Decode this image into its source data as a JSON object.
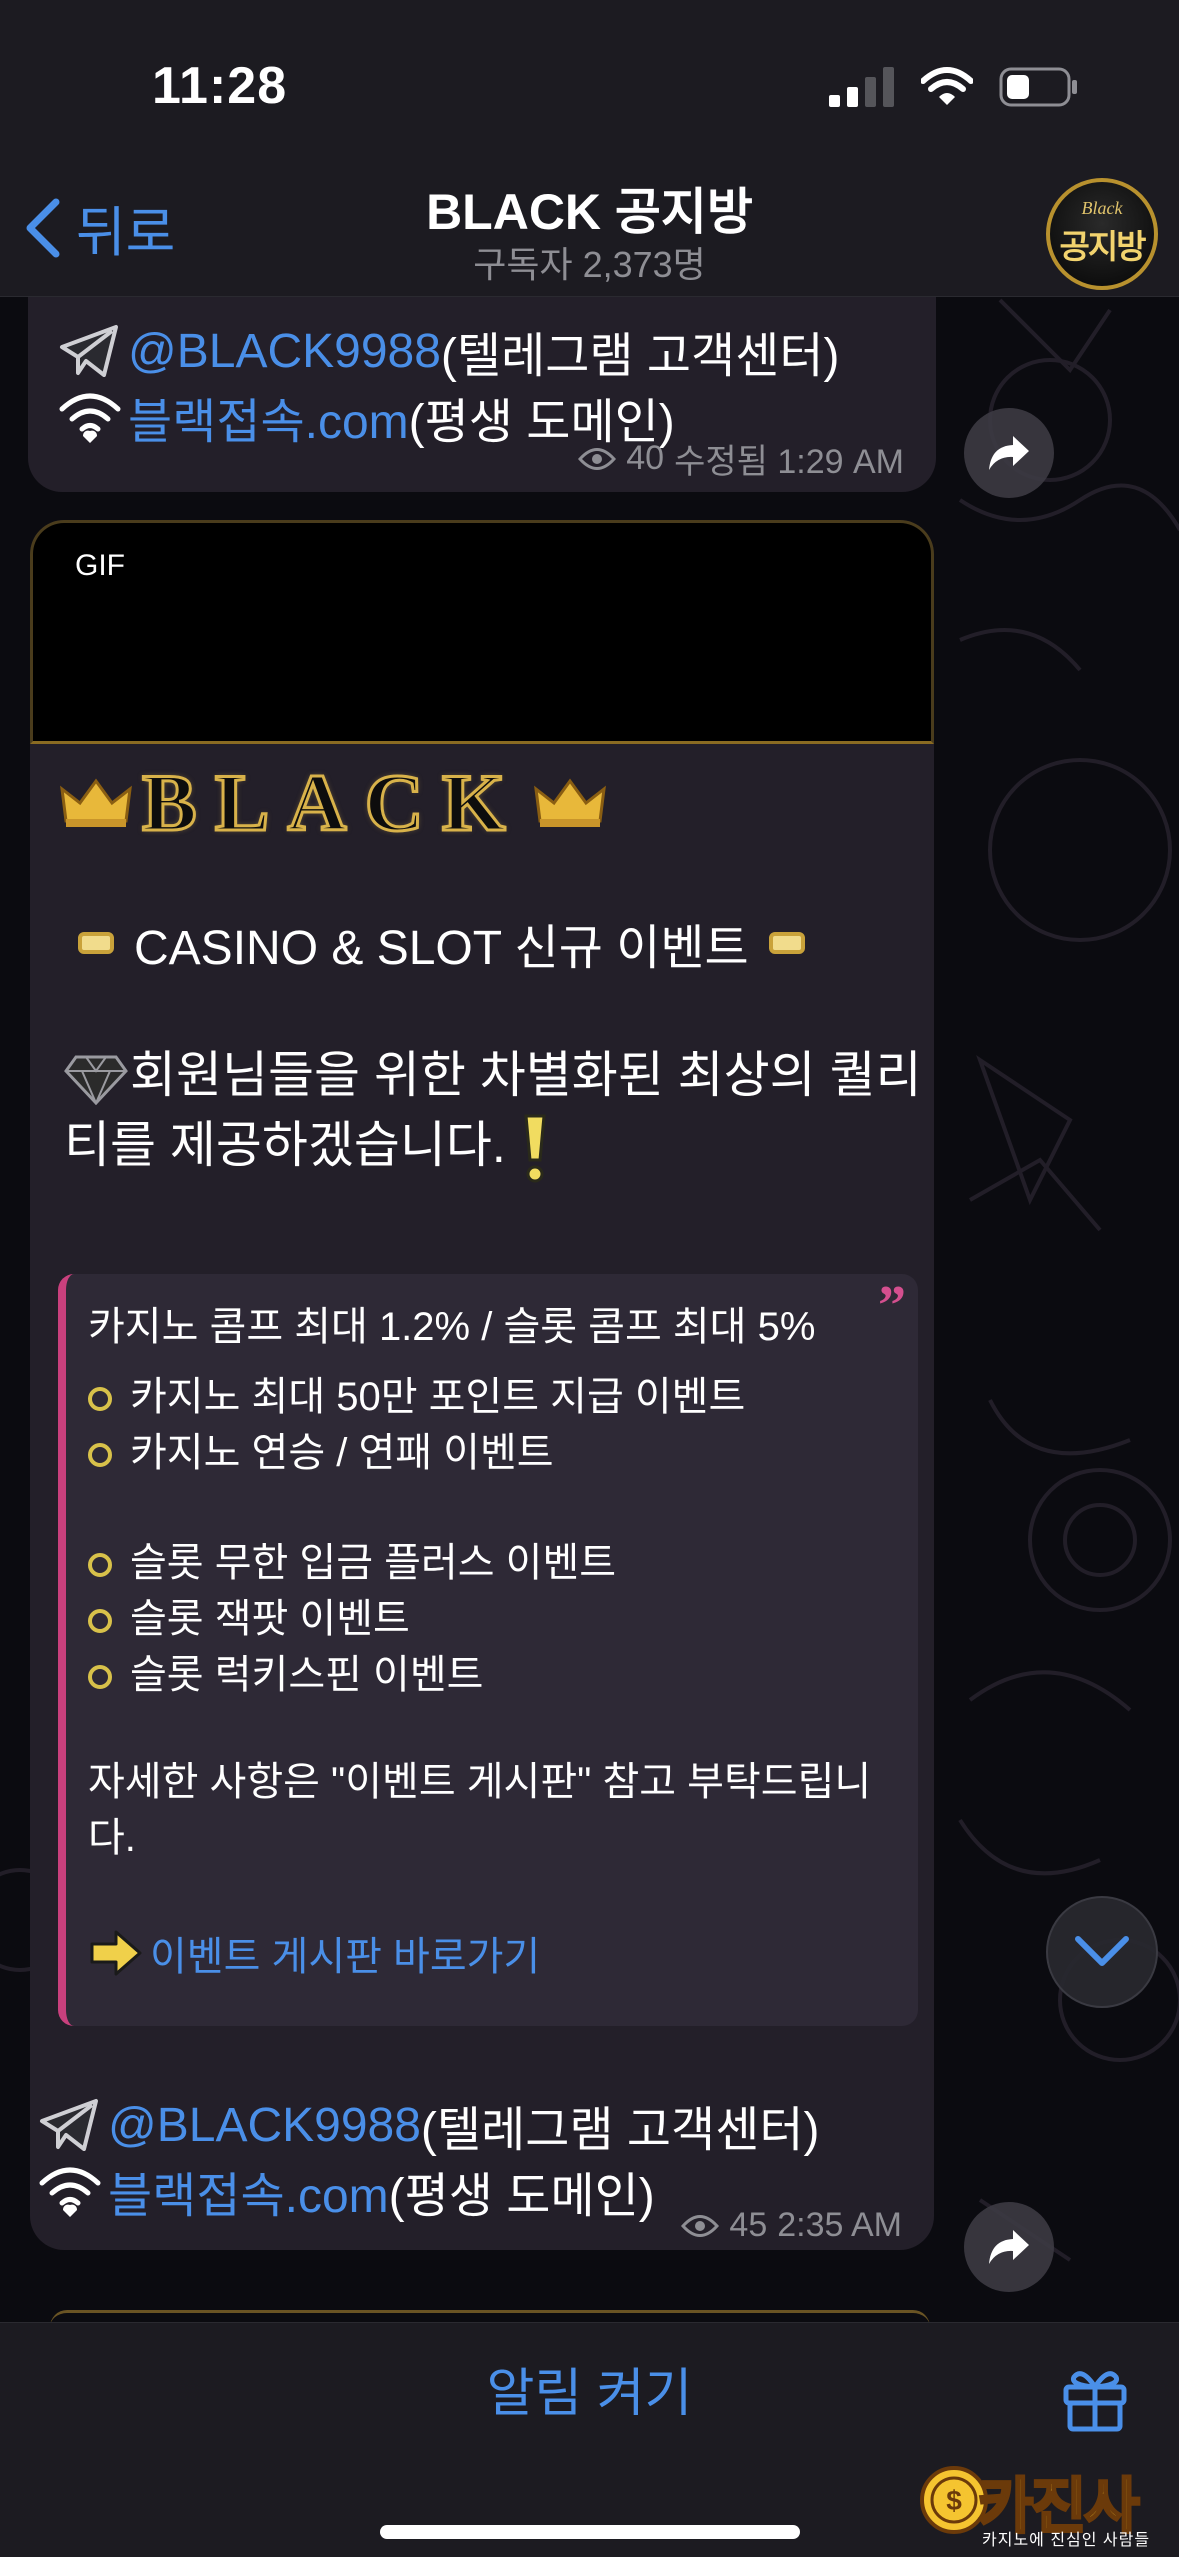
{
  "status": {
    "time": "11:28"
  },
  "header": {
    "back_label": "뒤로",
    "title": "BLACK 공지방",
    "subtitle": "구독자 2,373명",
    "avatar_small": "Black",
    "avatar_main": "공지방"
  },
  "message1": {
    "telegram_handle": "@BLACK9988",
    "telegram_desc": " (텔레그램 고객센터)",
    "domain_link": "블랙접속.com",
    "domain_desc": " (평생 도메인)",
    "views": "40",
    "meta": "수정됨 1:29 AM"
  },
  "message2": {
    "gif_label": "GIF",
    "logo_text": "BLACK",
    "event_title": "CASINO & SLOT 신규 이벤트",
    "intro": "회원님들을 위한 차별화된 최상의 퀄리티를 제공하겠습니다.",
    "quote": {
      "comp_line": "카지노 콤프 최대 1.2% / 슬롯 콤프 최대 5%",
      "casino_events": [
        "카지노 최대 50만 포인트 지급 이벤트",
        "카지노 연승 / 연패 이벤트"
      ],
      "slot_events": [
        "슬롯 무한 입금 플러스 이벤트",
        "슬롯 잭팟 이벤트",
        "슬롯 럭키스핀 이벤트"
      ],
      "detail": "자세한 사항은 \"이벤트 게시판\" 참고 부탁드립니다.",
      "link": "이벤트 게시판 바로가기"
    },
    "telegram_handle": "@BLACK9988",
    "telegram_desc": " (텔레그램 고객센터)",
    "domain_link": "블랙접속.com",
    "domain_desc": " (평생 도메인)",
    "views": "45",
    "time": "2:35 AM"
  },
  "bottom": {
    "notify_label": "알림 켜기"
  },
  "watermark": {
    "text": "카진사",
    "sub": "카지노에 진심인 사람들"
  },
  "colors": {
    "accent": "#4a8fe8",
    "quote_bar": "#c9407d",
    "gold": "#d8b24a"
  }
}
